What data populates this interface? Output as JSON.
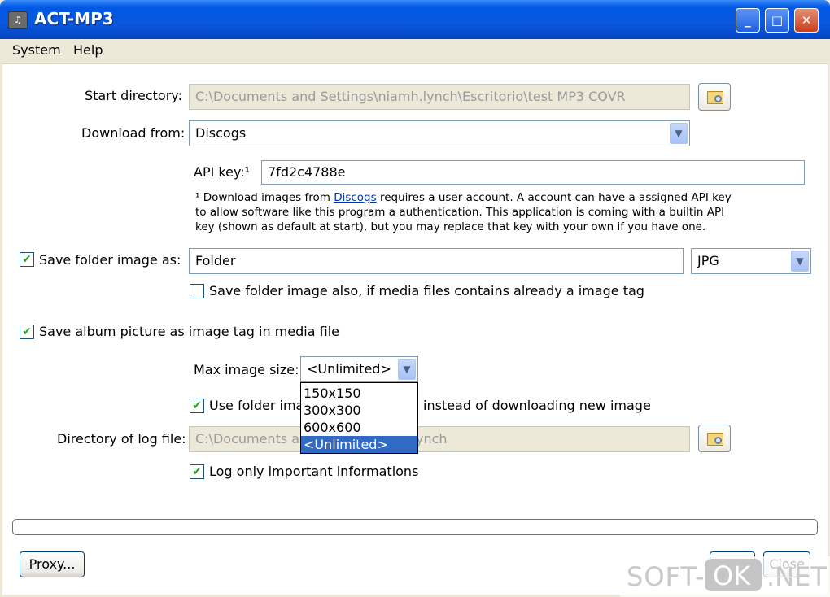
{
  "window": {
    "title": "ACT-MP3",
    "app_icon": "music-file-icon",
    "controls": {
      "minimize_glyph": "_",
      "maximize_glyph": "□",
      "close_glyph": "✕"
    }
  },
  "menu": {
    "items": [
      "System",
      "Help"
    ]
  },
  "form": {
    "start_directory": {
      "label": "Start directory:",
      "value": "C:\\Documents and Settings\\niamh.lynch\\Escritorio\\test MP3 COVR",
      "disabled": true,
      "browse_icon": "browse-folder-icon"
    },
    "download_from": {
      "label": "Download from:",
      "value": "Discogs"
    },
    "api_key": {
      "label": "API key:¹",
      "value": "7fd2c4788e"
    },
    "api_note": {
      "line1_pre": "¹ Download images from ",
      "line1_link": "Discogs",
      "line1_post": " requires a user account. A account can have a assigned API key",
      "line2": "to allow software like this program a authentication. This application is coming with a builtin API",
      "line3": "key (shown as default at start), but you may replace that key with your own if you have one."
    },
    "save_folder_image": {
      "label": "Save folder image as:",
      "checked": true,
      "value": "Folder",
      "format": "JPG"
    },
    "save_folder_also": {
      "label": "Save folder image also, if media files contains already a image tag",
      "checked": false
    },
    "save_album_tag": {
      "label": "Save album picture as image tag in media file",
      "checked": true
    },
    "max_image_size": {
      "label": "Max image size:",
      "value": "<Unlimited>",
      "options": [
        "150x150",
        "300x300",
        "600x600",
        "<Unlimited>"
      ],
      "selected_index": 3
    },
    "use_folder_image": {
      "label_visible_start": "Use folder imag",
      "label_visible_end": "instead of downloading new image",
      "checked": true
    },
    "log_directory": {
      "label": "Directory of log file:",
      "value_visible_start": "C:\\Documents an",
      "value_visible_end": "ynch",
      "disabled": true
    },
    "log_important": {
      "label": "Log only important informations",
      "checked": true
    }
  },
  "progress": {
    "value_percent": 0
  },
  "buttons": {
    "proxy": "Proxy...",
    "start": "Start",
    "close": "Close"
  },
  "watermark": {
    "pre": "SOFT-",
    "ok": "OK",
    "post": ".NET"
  }
}
